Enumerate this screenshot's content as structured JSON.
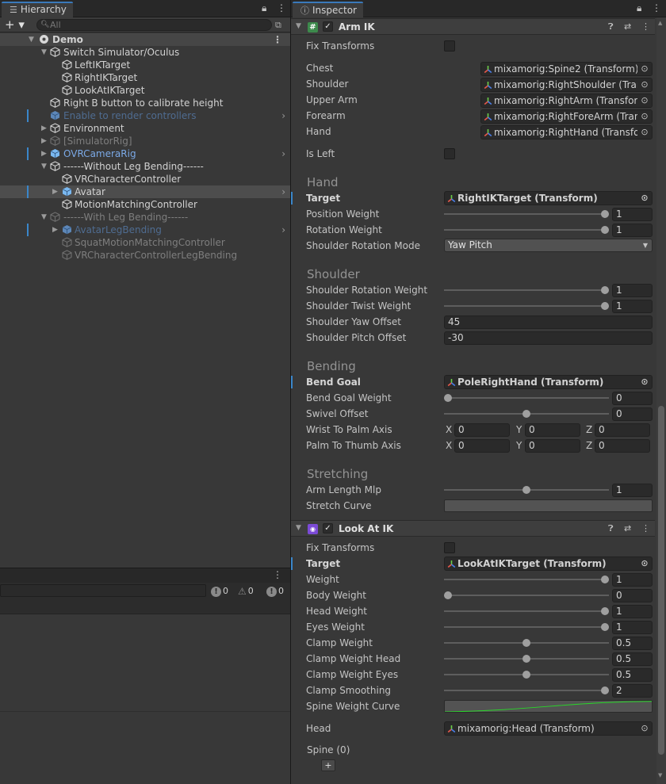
{
  "hierarchy": {
    "tab_title": "Hierarchy",
    "tab_icon": "list-icon",
    "search_placeholder": "All",
    "add_label": "+ ▾",
    "rows": [
      {
        "label": "Demo",
        "indent": 0,
        "kind": "scene",
        "expanded": true
      },
      {
        "label": "Switch Simulator/Oculus",
        "indent": 1,
        "kind": "normal",
        "expanded": true
      },
      {
        "label": "LeftIKTarget",
        "indent": 2,
        "kind": "normal"
      },
      {
        "label": "RightIKTarget",
        "indent": 2,
        "kind": "normal"
      },
      {
        "label": "LookAtIKTarget",
        "indent": 2,
        "kind": "normal"
      },
      {
        "label": "Right B button to calibrate height",
        "indent": 1,
        "kind": "normal"
      },
      {
        "label": "Enable to render controllers",
        "indent": 1,
        "kind": "bluedim",
        "prefab": true,
        "chevron": true,
        "marker": true
      },
      {
        "label": "Environment",
        "indent": 1,
        "kind": "normal",
        "expanded": false
      },
      {
        "label": "[SimulatorRig]",
        "indent": 1,
        "kind": "dim",
        "expanded": false
      },
      {
        "label": "OVRCameraRig",
        "indent": 1,
        "kind": "blue",
        "prefab": true,
        "expanded": false,
        "chevron": true,
        "marker": true
      },
      {
        "label": "------Without Leg Bending------",
        "indent": 1,
        "kind": "normal",
        "expanded": true
      },
      {
        "label": "VRCharacterController",
        "indent": 2,
        "kind": "normal"
      },
      {
        "label": "Avatar",
        "indent": 2,
        "kind": "selected",
        "prefab": true,
        "expanded": false,
        "chevron": true,
        "marker": true
      },
      {
        "label": "MotionMatchingController",
        "indent": 2,
        "kind": "normal"
      },
      {
        "label": "------With Leg Bending------",
        "indent": 1,
        "kind": "dim",
        "expanded": true
      },
      {
        "label": "AvatarLegBending",
        "indent": 2,
        "kind": "bluedim",
        "prefab": true,
        "expanded": false,
        "chevron": true,
        "marker": true
      },
      {
        "label": "SquatMotionMatchingController",
        "indent": 2,
        "kind": "dim"
      },
      {
        "label": "VRCharacterControllerLegBending",
        "indent": 2,
        "kind": "dim"
      }
    ]
  },
  "console": {
    "errors": "0",
    "warnings": "0",
    "messages": "0"
  },
  "inspector": {
    "tab_title": "Inspector",
    "tab_icon": "info-icon",
    "arm_ik": {
      "title": "Arm IK",
      "enabled": true,
      "fix_transforms_label": "Fix Transforms",
      "chest_label": "Chest",
      "chest_value": "mixamorig:Spine2 (Transform)",
      "shoulder_label": "Shoulder",
      "shoulder_value": "mixamorig:RightShoulder (Transform)",
      "upper_arm_label": "Upper Arm",
      "upper_arm_value": "mixamorig:RightArm (Transform)",
      "forearm_label": "Forearm",
      "forearm_value": "mixamorig:RightForeArm (Transform)",
      "hand_label": "Hand",
      "hand_value": "mixamorig:RightHand (Transform)",
      "is_left_label": "Is Left",
      "hand_section": "Hand",
      "target_label": "Target",
      "target_value": "RightIKTarget (Transform)",
      "position_weight_label": "Position Weight",
      "position_weight": "1",
      "rotation_weight_label": "Rotation Weight",
      "rotation_weight": "1",
      "shoulder_rotation_mode_label": "Shoulder Rotation Mode",
      "shoulder_rotation_mode": "Yaw Pitch",
      "shoulder_section": "Shoulder",
      "shoulder_rotation_weight_label": "Shoulder Rotation Weight",
      "shoulder_rotation_weight": "1",
      "shoulder_twist_weight_label": "Shoulder Twist Weight",
      "shoulder_twist_weight": "1",
      "shoulder_yaw_offset_label": "Shoulder Yaw Offset",
      "shoulder_yaw_offset": "45",
      "shoulder_pitch_offset_label": "Shoulder Pitch Offset",
      "shoulder_pitch_offset": "-30",
      "bending_section": "Bending",
      "bend_goal_label": "Bend Goal",
      "bend_goal_value": "PoleRightHand (Transform)",
      "bend_goal_weight_label": "Bend Goal Weight",
      "bend_goal_weight": "0",
      "swivel_offset_label": "Swivel Offset",
      "swivel_offset": "0",
      "wrist_to_palm_label": "Wrist To Palm Axis",
      "wrist_to_palm": {
        "x": "0",
        "y": "0",
        "z": "0"
      },
      "palm_to_thumb_label": "Palm To Thumb Axis",
      "palm_to_thumb": {
        "x": "0",
        "y": "0",
        "z": "0"
      },
      "stretching_section": "Stretching",
      "arm_length_mlp_label": "Arm Length Mlp",
      "arm_length_mlp": "1",
      "stretch_curve_label": "Stretch Curve"
    },
    "look_at_ik": {
      "title": "Look At IK",
      "enabled": true,
      "fix_transforms_label": "Fix Transforms",
      "target_label": "Target",
      "target_value": "LookAtIKTarget (Transform)",
      "weight_label": "Weight",
      "weight": "1",
      "body_weight_label": "Body Weight",
      "body_weight": "0",
      "head_weight_label": "Head Weight",
      "head_weight": "1",
      "eyes_weight_label": "Eyes Weight",
      "eyes_weight": "1",
      "clamp_weight_label": "Clamp Weight",
      "clamp_weight": "0.5",
      "clamp_weight_head_label": "Clamp Weight Head",
      "clamp_weight_head": "0.5",
      "clamp_weight_eyes_label": "Clamp Weight Eyes",
      "clamp_weight_eyes": "0.5",
      "clamp_smoothing_label": "Clamp Smoothing",
      "clamp_smoothing": "2",
      "spine_weight_curve_label": "Spine Weight Curve",
      "head_label": "Head",
      "head_value": "mixamorig:Head (Transform)",
      "spine_label": "Spine (0)",
      "add_label": "+"
    },
    "xyz_labels": {
      "x": "X",
      "y": "Y",
      "z": "Z"
    }
  },
  "colors": {
    "panel_bg": "#383838",
    "selection_marker": "#3a86c9",
    "prefab_blue": "#7ba9e6",
    "curve_green": "#29d629"
  }
}
